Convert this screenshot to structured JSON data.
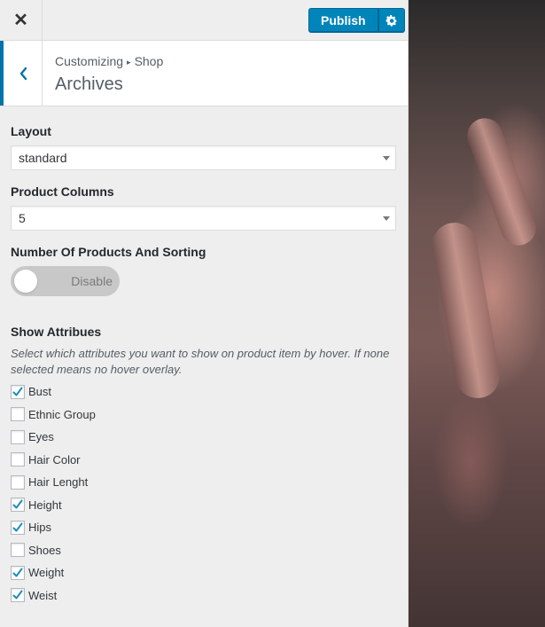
{
  "topbar": {
    "close_label": "✕",
    "publish_label": "Publish",
    "settings_icon": "gear-icon"
  },
  "header": {
    "breadcrumb_root": "Customizing",
    "breadcrumb_separator": "▸",
    "breadcrumb_parent": "Shop",
    "title": "Archives"
  },
  "layout": {
    "label": "Layout",
    "value": "standard"
  },
  "columns": {
    "label": "Product Columns",
    "value": "5"
  },
  "sorting": {
    "label": "Number Of Products And Sorting",
    "state": "Disable",
    "enabled": false
  },
  "attributes": {
    "label": "Show Attribues",
    "description": "Select which attributes you want to show on product item by hover. If none selected means no hover overlay.",
    "items": [
      {
        "label": "Bust",
        "checked": true
      },
      {
        "label": "Ethnic Group",
        "checked": false
      },
      {
        "label": "Eyes",
        "checked": false
      },
      {
        "label": "Hair Color",
        "checked": false
      },
      {
        "label": "Hair Lenght",
        "checked": false
      },
      {
        "label": "Height",
        "checked": true
      },
      {
        "label": "Hips",
        "checked": true
      },
      {
        "label": "Shoes",
        "checked": false
      },
      {
        "label": "Weight",
        "checked": true
      },
      {
        "label": "Weist",
        "checked": true
      }
    ]
  },
  "colors": {
    "accent": "#0085ba",
    "check": "#1e8cbe"
  }
}
